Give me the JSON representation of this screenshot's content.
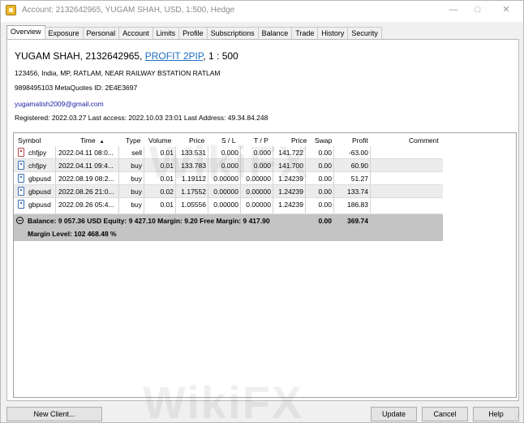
{
  "window": {
    "title": "Account: 2132642965, YUGAM SHAH, USD, 1:500, Hedge",
    "minimize": "—",
    "maximize": "□",
    "close": "✕"
  },
  "tabs": [
    "Overview",
    "Exposure",
    "Personal",
    "Account",
    "Limits",
    "Profile",
    "Subscriptions",
    "Balance",
    "Trade",
    "History",
    "Security"
  ],
  "account": {
    "title_prefix": "YUGAM SHAH, 2132642965, ",
    "group": "PROFIT 2PIP",
    "title_suffix": ", 1 : 500",
    "address": "123456, India, MP, RATLAM, NEAR RAILWAY BSTATION RATLAM",
    "phone_line": "9898495103  MetaQuotes ID: 2E4E3697",
    "email": "yugamatish2009@gmail.com",
    "registered_line": "Registered: 2022.03.27   Last access: 2022.10.03 23:01   Last Address: 49.34.84.248"
  },
  "table": {
    "headers": {
      "symbol": "Symbol",
      "time": "Time",
      "sort_arrow": "▲",
      "type": "Type",
      "volume": "Volume",
      "price": "Price",
      "sl": "S / L",
      "tp": "T / P",
      "price2": "Price",
      "swap": "Swap",
      "profit": "Profit",
      "comment": "Comment"
    },
    "rows": [
      {
        "symbol": "chfjpy",
        "time": "2022.04.11 08:0...",
        "type": "sell",
        "volume": "0.01",
        "price": "133.531",
        "sl": "0.000",
        "tp": "0.000",
        "price2": "141.722",
        "swap": "0.00",
        "profit": "-63.00",
        "comment": ""
      },
      {
        "symbol": "chfjpy",
        "time": "2022.04.11 09:4...",
        "type": "buy",
        "volume": "0.01",
        "price": "133.783",
        "sl": "0.000",
        "tp": "0.000",
        "price2": "141.700",
        "swap": "0.00",
        "profit": "60.90",
        "comment": ""
      },
      {
        "symbol": "gbpusd",
        "time": "2022.08.19 08:2...",
        "type": "buy",
        "volume": "0.01",
        "price": "1.19112",
        "sl": "0.00000",
        "tp": "0.00000",
        "price2": "1.24239",
        "swap": "0.00",
        "profit": "51.27",
        "comment": ""
      },
      {
        "symbol": "gbpusd",
        "time": "2022.08.26 21:0...",
        "type": "buy",
        "volume": "0.02",
        "price": "1.17552",
        "sl": "0.00000",
        "tp": "0.00000",
        "price2": "1.24239",
        "swap": "0.00",
        "profit": "133.74",
        "comment": ""
      },
      {
        "symbol": "gbpusd",
        "time": "2022.09.26 05:4...",
        "type": "buy",
        "volume": "0.01",
        "price": "1.05556",
        "sl": "0.00000",
        "tp": "0.00000",
        "price2": "1.24239",
        "swap": "0.00",
        "profit": "186.83",
        "comment": ""
      }
    ],
    "summary": {
      "icon": "−",
      "line1": "Balance: 9 057.36 USD  Equity: 9 427.10  Margin: 9.20  Free Margin: 9 417.90",
      "swap": "0.00",
      "profit": "369.74",
      "line2": "Margin Level: 102 468.48 %"
    }
  },
  "buttons": {
    "new_client": "New Client...",
    "update": "Update",
    "cancel": "Cancel",
    "help": "Help"
  },
  "watermark": "WikiFX",
  "colors": {
    "link": "#1e6fbf",
    "email": "#1a1aa6",
    "summary_bg": "#c4c4c4",
    "sell_icon": "#c04040",
    "buy_icon": "#3c6fb5"
  }
}
